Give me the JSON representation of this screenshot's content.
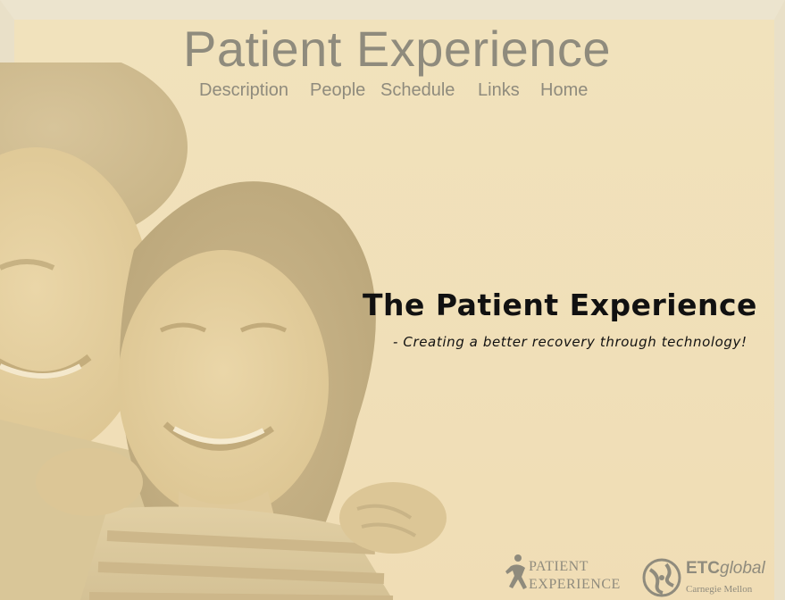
{
  "site": {
    "title": "Patient  Experience",
    "nav": {
      "description": "Description",
      "people": "People",
      "schedule": "Schedule",
      "links": "Links",
      "home": "Home"
    }
  },
  "hero": {
    "headline": "The Patient Experience",
    "tagline": "- Creating a better recovery through technology!"
  },
  "footer_logos": {
    "patient_experience_line1": "PATIENT",
    "patient_experience_line2": "EXPERIENCE",
    "etc_brand_bold": "ETC",
    "etc_brand_italic": "global",
    "etc_sub": "Carnegie Mellon"
  },
  "colors": {
    "background": "#efe2c0",
    "muted_text": "#8f8b7d",
    "headline_text": "#111111"
  }
}
